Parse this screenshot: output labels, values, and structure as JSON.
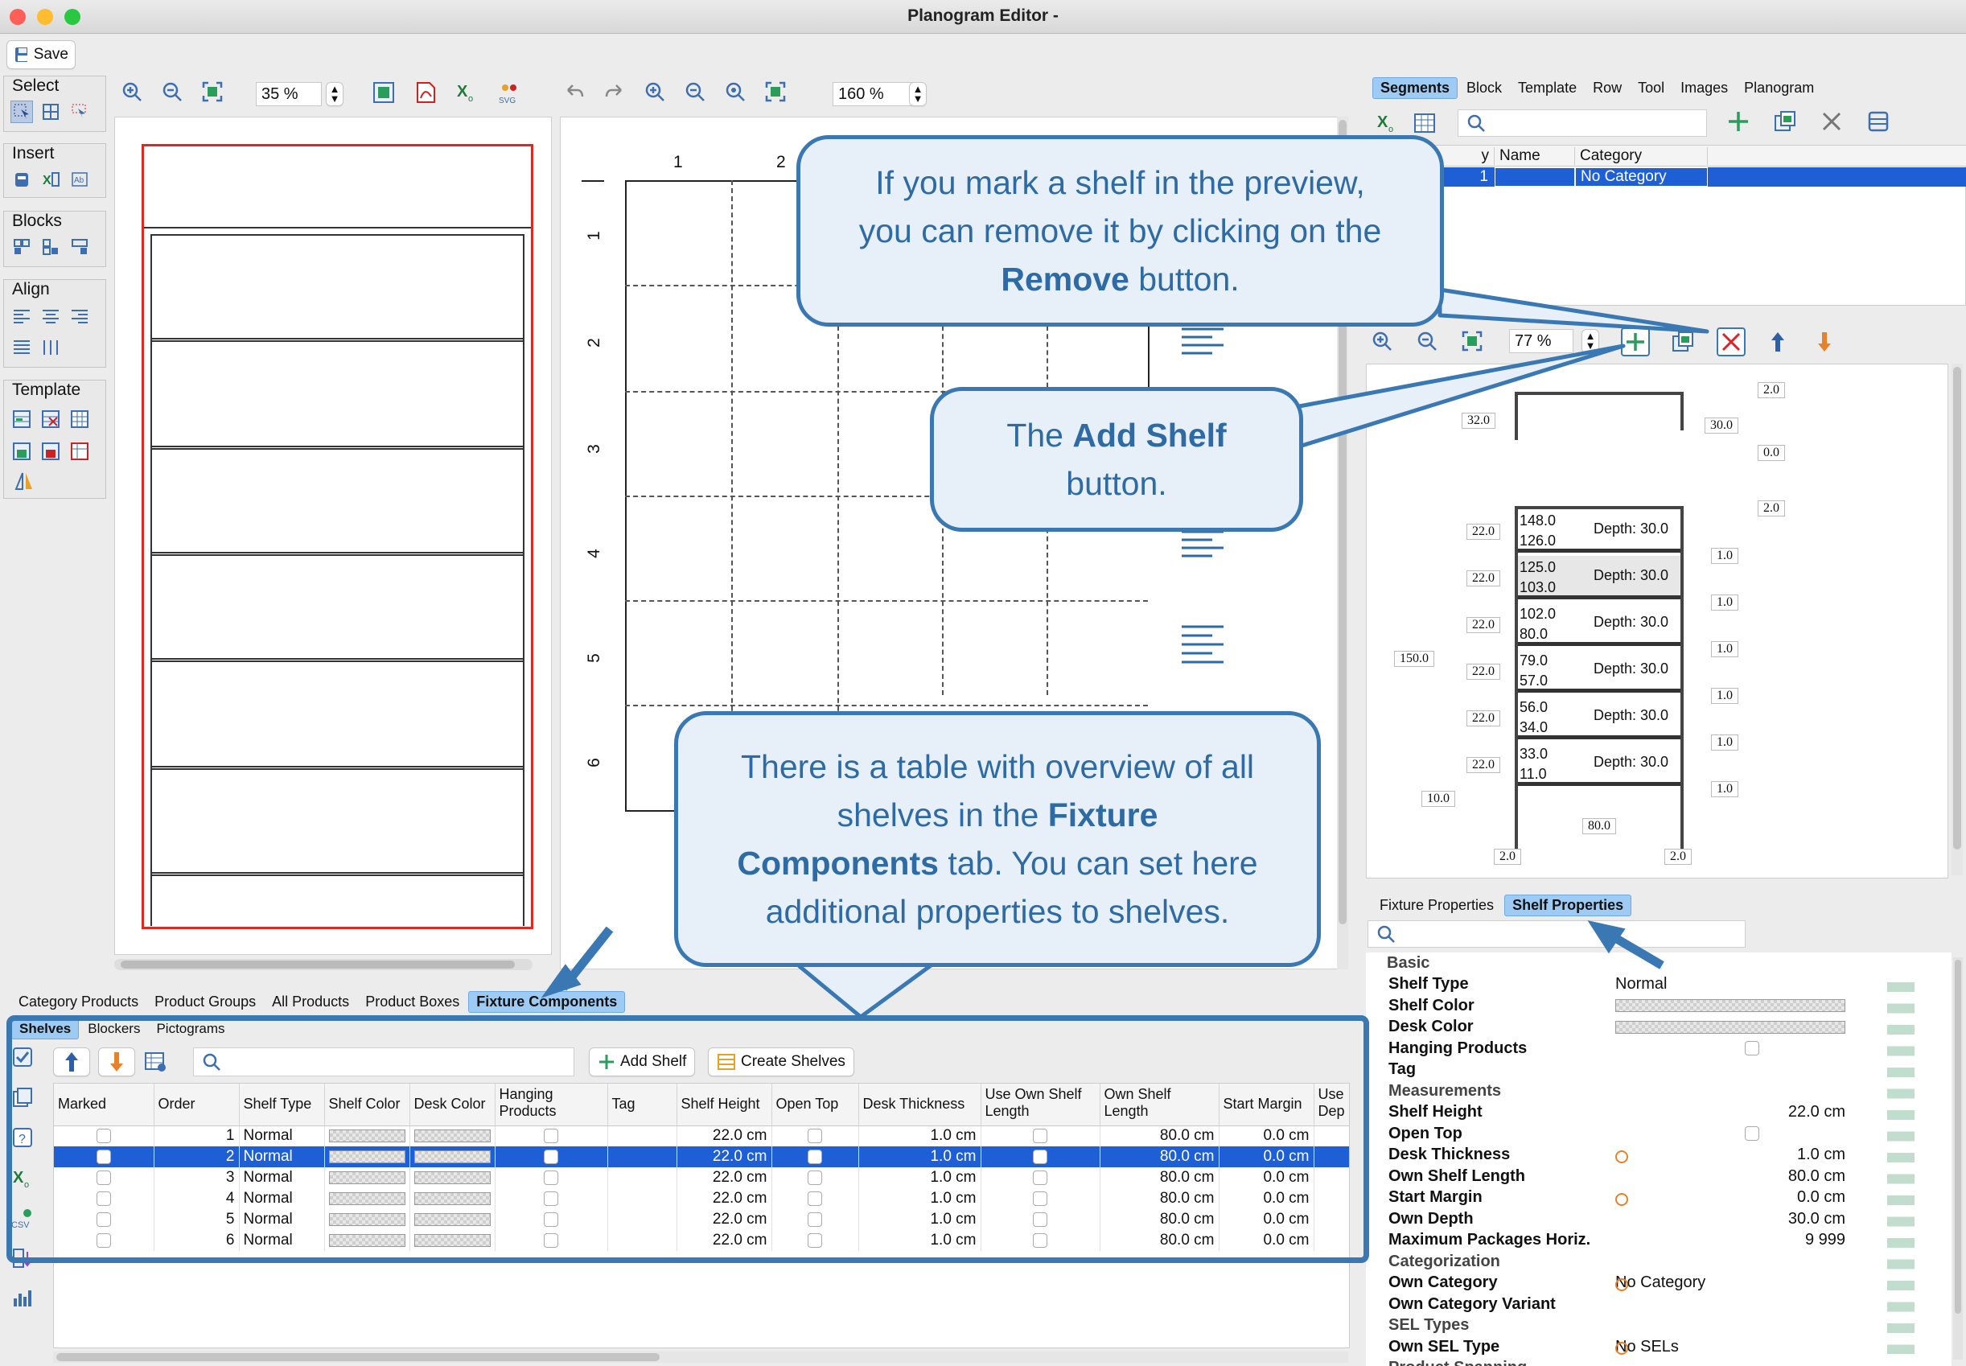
{
  "window": {
    "title": "Planogram Editor -"
  },
  "toolbar": {
    "save_label": "Save"
  },
  "left_tools": {
    "groups": [
      "Select",
      "Insert",
      "Blocks",
      "Align",
      "Template"
    ]
  },
  "preview_left": {
    "zoom": "35 %"
  },
  "preview_center": {
    "zoom": "160 %",
    "col_numbers": [
      "1",
      "2"
    ],
    "row_numbers": [
      "1",
      "2",
      "3",
      "4",
      "5",
      "6"
    ]
  },
  "right_tabs": {
    "items": [
      "Segments",
      "Block",
      "Template",
      "Row",
      "Tool",
      "Images",
      "Planogram"
    ],
    "selected": "Segments"
  },
  "segments_table": {
    "headers": [
      "y",
      "Name",
      "Category"
    ],
    "rows": [
      {
        "id": "1",
        "name": "",
        "category": "No Category"
      }
    ]
  },
  "segment_preview": {
    "zoom": "77 %",
    "top_dims": {
      "left": "32.0",
      "right_top": "2.0",
      "right_mid": "30.0",
      "right_bot": "0.0",
      "gap": "2.0"
    },
    "total_height": "150.0",
    "base_height": "10.0",
    "width": "80.0",
    "bottom_left": "2.0",
    "bottom_right": "2.0",
    "shelves": [
      {
        "top": "148.0",
        "bottom": "126.0",
        "depth": "Depth: 30.0",
        "height": "22.0",
        "thickness": "1.0"
      },
      {
        "top": "125.0",
        "bottom": "103.0",
        "depth": "Depth: 30.0",
        "height": "22.0",
        "thickness": "1.0"
      },
      {
        "top": "102.0",
        "bottom": "80.0",
        "depth": "Depth: 30.0",
        "height": "22.0",
        "thickness": "1.0"
      },
      {
        "top": "79.0",
        "bottom": "57.0",
        "depth": "Depth: 30.0",
        "height": "22.0",
        "thickness": "1.0"
      },
      {
        "top": "56.0",
        "bottom": "34.0",
        "depth": "Depth: 30.0",
        "height": "22.0",
        "thickness": "1.0"
      },
      {
        "top": "33.0",
        "bottom": "11.0",
        "depth": "Depth: 30.0",
        "height": "22.0",
        "thickness": "1.0"
      }
    ]
  },
  "prop_tabs": {
    "items": [
      "Fixture Properties",
      "Shelf Properties"
    ],
    "selected": "Shelf Properties"
  },
  "properties": {
    "sections": [
      {
        "title": "Basic",
        "rows": [
          {
            "key": "Shelf Type",
            "value": "Normal",
            "kind": "text"
          },
          {
            "key": "Shelf Color",
            "value": "",
            "kind": "swatch"
          },
          {
            "key": "Desk Color",
            "value": "",
            "kind": "swatch"
          },
          {
            "key": "Hanging Products",
            "value": "",
            "kind": "check"
          },
          {
            "key": "Tag",
            "value": "",
            "kind": "text"
          }
        ]
      },
      {
        "title": "Measurements",
        "rows": [
          {
            "key": "Shelf Height",
            "value": "22.0 cm",
            "kind": "num"
          },
          {
            "key": "Open Top",
            "value": "",
            "kind": "check"
          },
          {
            "key": "Desk Thickness",
            "value": "1.0 cm",
            "kind": "num"
          },
          {
            "key": "Own Shelf Length",
            "value": "80.0 cm",
            "kind": "num",
            "override": true
          },
          {
            "key": "Start Margin",
            "value": "0.0 cm",
            "kind": "num"
          },
          {
            "key": "Own Depth",
            "value": "30.0 cm",
            "kind": "num",
            "override": true
          },
          {
            "key": "Maximum Packages Horiz...",
            "value": "9 999",
            "kind": "num"
          }
        ]
      },
      {
        "title": "Categorization",
        "rows": [
          {
            "key": "Own Category",
            "value": "No Category",
            "kind": "text",
            "override": true
          },
          {
            "key": "Own Category Variant",
            "value": "",
            "kind": "text"
          }
        ]
      },
      {
        "title": "SEL Types",
        "rows": [
          {
            "key": "Own SEL Type",
            "value": "No SELs",
            "kind": "text",
            "override": true
          }
        ]
      },
      {
        "title": "Product Spanning",
        "rows": []
      }
    ]
  },
  "bottom_tabs": {
    "items": [
      "Category Products",
      "Product Groups",
      "All Products",
      "Product Boxes",
      "Fixture Components"
    ],
    "selected": "Fixture Components"
  },
  "sub_tabs": {
    "items": [
      "Shelves",
      "Blockers",
      "Pictograms"
    ],
    "selected": "Shelves"
  },
  "shelves_toolbar": {
    "add_shelf": "Add Shelf",
    "create_shelves": "Create Shelves"
  },
  "shelves_table": {
    "headers": [
      "Marked",
      "Order",
      "Shelf Type",
      "Shelf Color",
      "Desk Color",
      "Hanging Products",
      "Tag",
      "Shelf Height",
      "Open Top",
      "Desk Thickness",
      "Use Own Shelf Length",
      "Own Shelf Length",
      "Start Margin",
      "Use Dep"
    ],
    "rows": [
      {
        "order": "1",
        "type": "Normal",
        "height": "22.0 cm",
        "thickness": "1.0 cm",
        "length": "80.0 cm",
        "margin": "0.0 cm"
      },
      {
        "order": "2",
        "type": "Normal",
        "height": "22.0 cm",
        "thickness": "1.0 cm",
        "length": "80.0 cm",
        "margin": "0.0 cm"
      },
      {
        "order": "3",
        "type": "Normal",
        "height": "22.0 cm",
        "thickness": "1.0 cm",
        "length": "80.0 cm",
        "margin": "0.0 cm"
      },
      {
        "order": "4",
        "type": "Normal",
        "height": "22.0 cm",
        "thickness": "1.0 cm",
        "length": "80.0 cm",
        "margin": "0.0 cm"
      },
      {
        "order": "5",
        "type": "Normal",
        "height": "22.0 cm",
        "thickness": "1.0 cm",
        "length": "80.0 cm",
        "margin": "0.0 cm"
      },
      {
        "order": "6",
        "type": "Normal",
        "height": "22.0 cm",
        "thickness": "1.0 cm",
        "length": "80.0 cm",
        "margin": "0.0 cm"
      }
    ],
    "selected_order": "2"
  },
  "callouts": {
    "remove": {
      "line1": "If you mark a shelf in the preview,",
      "line2": "you can remove it by clicking on the",
      "bold": "Remove",
      "tail": " button."
    },
    "add": {
      "pre": "The ",
      "bold": "Add Shelf",
      "line2": "button."
    },
    "table": {
      "line1": "There is a table with overview of all",
      "line2a": "shelves in the ",
      "bold1": "Fixture",
      "bold2": "Components",
      "line3b": " tab. You can set here",
      "line4": "additional properties to shelves."
    }
  },
  "colors": {
    "accent": "#3a78b3",
    "selection": "#1f5fd6",
    "tab_selected": "#9ecbf4",
    "callout_bg": "#e7f0f8",
    "fixture_border": "#e0281e"
  }
}
